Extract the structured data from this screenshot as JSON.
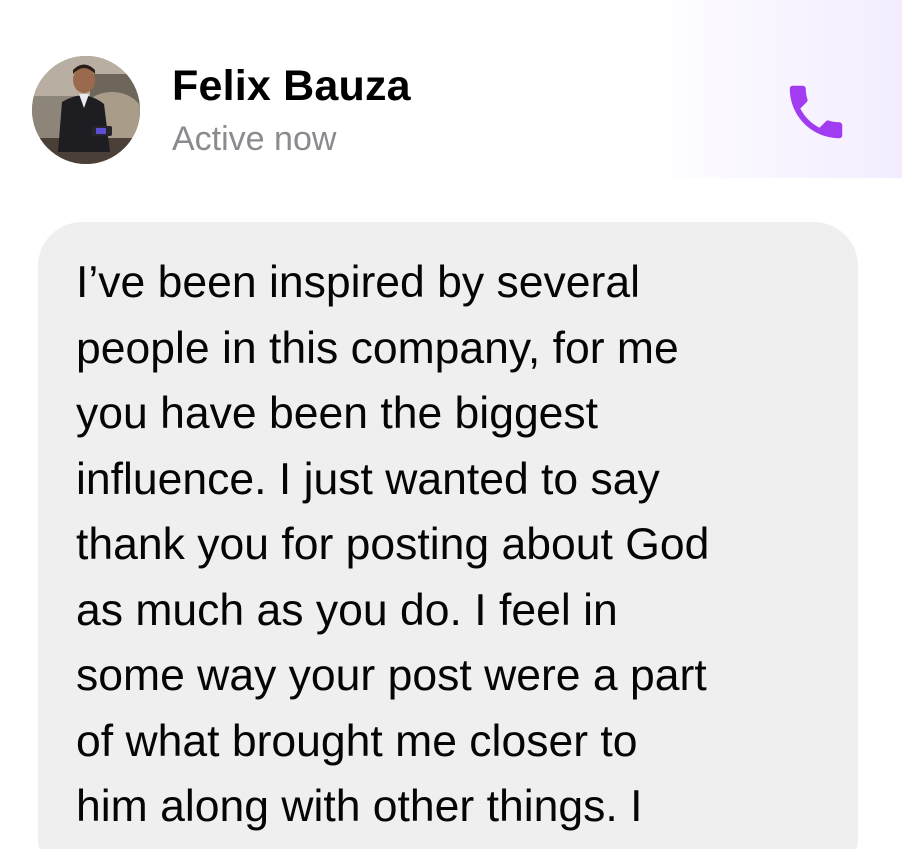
{
  "conversation_header": {
    "name": "Felix Bauza",
    "status": "Active now",
    "avatar_icon": "profile-photo",
    "call_icon": "phone-icon",
    "accent_color": "#a23cf0"
  },
  "message": {
    "text": "I’ve been inspired by several\npeople in this company, for me\nyou have been the biggest\ninfluence. I just wanted to say\nthank you for posting about God\nas much as you do. I feel in\nsome way your post were a part\nof what brought me closer to\nhim along with other things. I",
    "bubble_color": "#efeff0"
  }
}
